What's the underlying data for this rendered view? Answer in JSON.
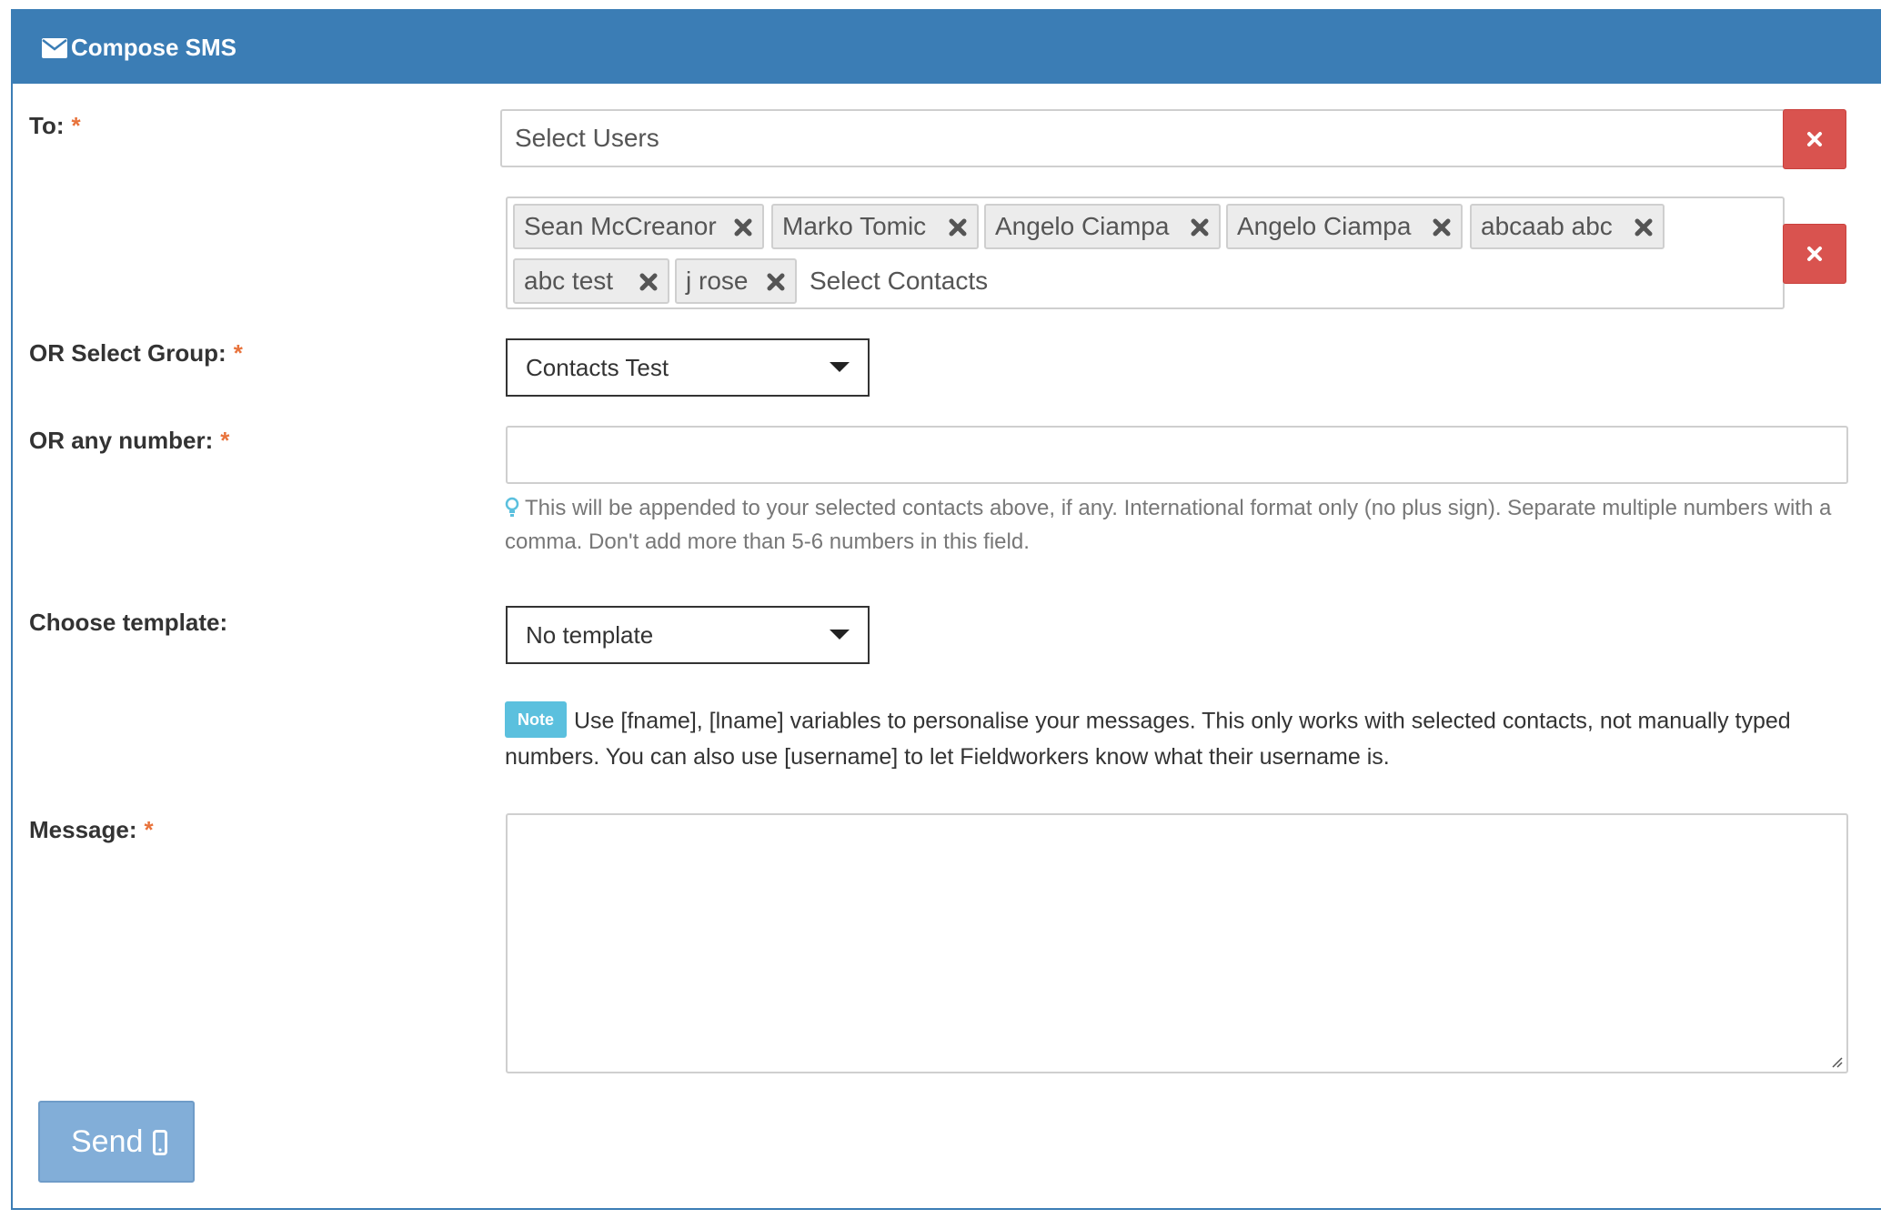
{
  "panel": {
    "title": "Compose SMS",
    "title_icon": "envelope-icon"
  },
  "form": {
    "to": {
      "label": "To:",
      "required_mark": "*",
      "users_placeholder": "Select Users",
      "contacts_placeholder": "Select Contacts",
      "selected_contacts": [
        "Sean McCreanor",
        "Marko Tomic",
        "Angelo Ciampa",
        "Angelo Ciampa",
        "abcaab abc",
        "abc test",
        "j rose"
      ]
    },
    "group": {
      "label": "OR Select Group:",
      "required_mark": "*",
      "selected": "Contacts Test"
    },
    "number": {
      "label": "OR any number:",
      "required_mark": "*",
      "value": "",
      "help_icon": "lightbulb-icon",
      "help": "This will be appended to your selected contacts above, if any. International format only (no plus sign). Separate multiple numbers with a comma. Don't add more than 5-6 numbers in this field."
    },
    "template": {
      "label": "Choose template:",
      "selected": "No template"
    },
    "note": {
      "badge": "Note",
      "text": "Use [fname], [lname] variables to personalise your messages. This only works with selected contacts, not manually typed numbers. You can also use [username] to let Fieldworkers know what their username is."
    },
    "message": {
      "label": "Message:",
      "required_mark": "*",
      "value": ""
    },
    "send": {
      "label": "Send",
      "icon": "mobile-phone-icon"
    }
  },
  "colors": {
    "heading_bg": "#3b7db5",
    "required": "#e8733c",
    "danger": "#d9534f",
    "note_badge": "#5bc0de",
    "send_button": "#82aed8"
  }
}
